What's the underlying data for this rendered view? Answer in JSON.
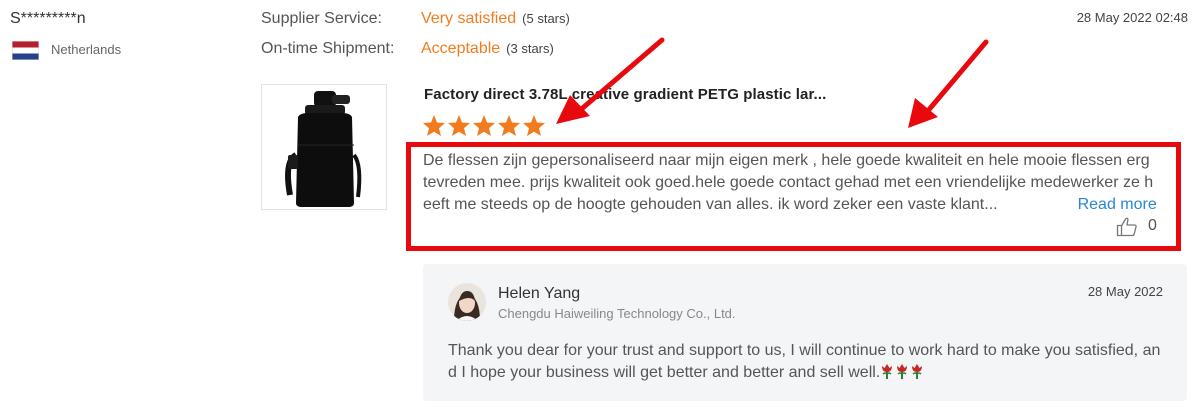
{
  "buyer": {
    "name": "S*********n",
    "country": "Netherlands"
  },
  "ratings": {
    "supplier_service": {
      "label": "Supplier Service:",
      "value": "Very satisfied",
      "note": "(5 stars)"
    },
    "ontime_shipment": {
      "label": "On-time Shipment:",
      "value": "Acceptable",
      "note": "(3 stars)"
    }
  },
  "review_date": "28 May 2022 02:48",
  "product": {
    "title": "Factory direct 3.78L creative gradient PETG plastic lar...",
    "rating": 5
  },
  "review": {
    "text": "De flessen zijn gepersonaliseerd naar mijn eigen merk , hele goede kwaliteit en hele mooie flessen erg tevreden mee. prijs kwaliteit ook goed.hele goede contact gehad met een vriendelijke medewerker ze heeft me steeds op de hoogte gehouden van alles. ik word zeker een vaste klant...",
    "read_more": "Read more",
    "likes": "0"
  },
  "reply": {
    "name": "Helen Yang",
    "company": "Chengdu Haiweiling Technology Co., Ltd.",
    "date": "28 May 2022",
    "text": "Thank you dear for your trust and support to us, I will continue to work hard to make you satisfied, and I hope your business will get better and better and sell well."
  },
  "colors": {
    "accent": "#f07c1f",
    "highlight": "#e8090e",
    "link": "#2a87d0"
  },
  "icons": {
    "flag": "netherlands-flag-icon",
    "like": "thumbs-up-icon",
    "star": "star-icon",
    "rose": "rose-emoji"
  }
}
